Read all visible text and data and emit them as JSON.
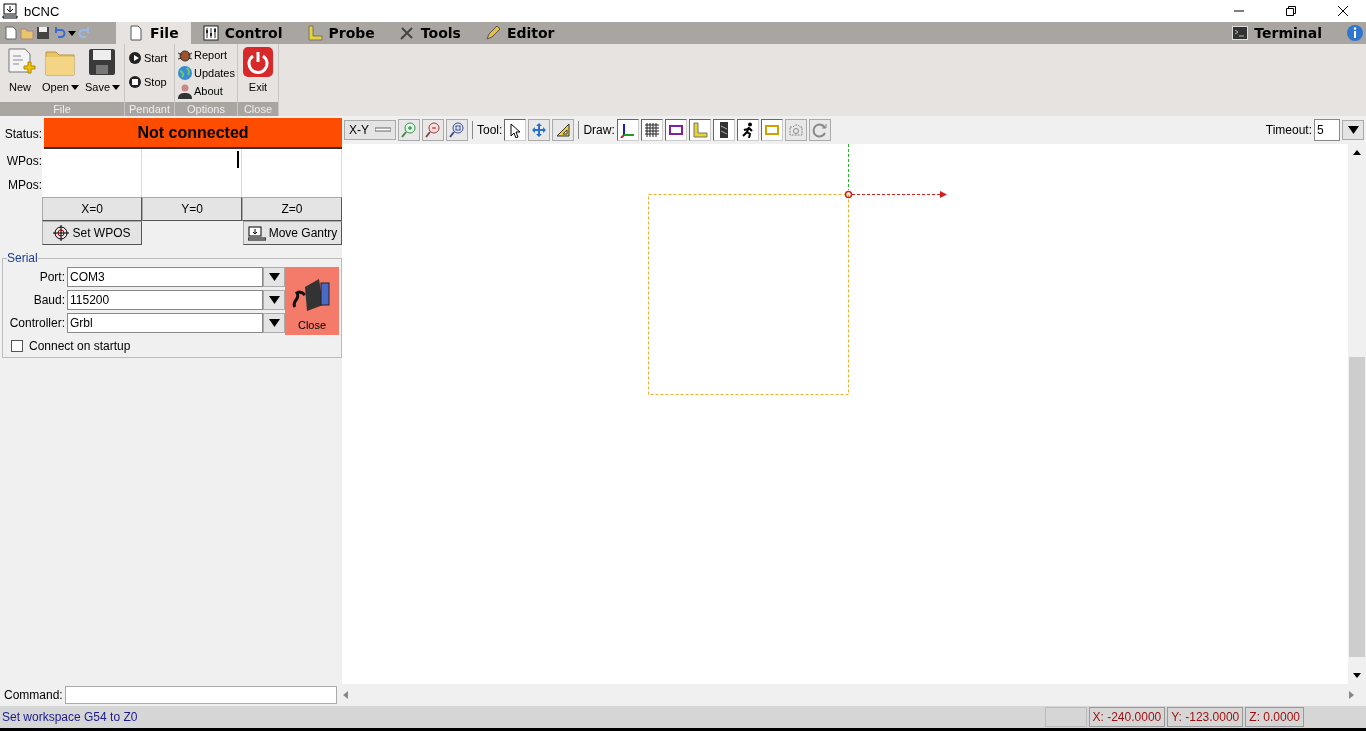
{
  "window": {
    "title": "bCNC"
  },
  "tabs": [
    {
      "label": "File",
      "kind": "file",
      "selected": true
    },
    {
      "label": "Control",
      "kind": "control",
      "selected": false
    },
    {
      "label": "Probe",
      "kind": "probe",
      "selected": false
    },
    {
      "label": "Tools",
      "kind": "tools",
      "selected": false
    },
    {
      "label": "Editor",
      "kind": "editor",
      "selected": false
    }
  ],
  "terminal_tab": {
    "label": "Terminal",
    "selected": false
  },
  "ribbon_groups": [
    {
      "label": "File",
      "kind": "large",
      "buttons": [
        {
          "label": "New",
          "kind": "new",
          "menu": false
        },
        {
          "label": "Open",
          "kind": "open",
          "menu": true
        },
        {
          "label": "Save",
          "kind": "save",
          "menu": true
        }
      ]
    },
    {
      "label": "Pendant",
      "kind": "small",
      "buttons": [
        {
          "label": "Start",
          "kind": "start"
        },
        {
          "label": "Stop",
          "kind": "stop"
        }
      ]
    },
    {
      "label": "Options",
      "kind": "small",
      "buttons": [
        {
          "label": "Report",
          "kind": "report"
        },
        {
          "label": "Updates",
          "kind": "updates"
        },
        {
          "label": "About",
          "kind": "about"
        }
      ]
    },
    {
      "label": "Close",
      "kind": "large",
      "buttons": [
        {
          "label": "Exit",
          "kind": "exit",
          "menu": false
        }
      ]
    }
  ],
  "status": {
    "label": "Status:",
    "value": "Not connected"
  },
  "position_rows": [
    "WPos:",
    "MPos:"
  ],
  "zero_buttons": [
    "X=0",
    "Y=0",
    "Z=0"
  ],
  "set_wpos": "Set WPOS",
  "move_gantry": "Move Gantry",
  "serial": {
    "title": "Serial",
    "fields": [
      {
        "label": "Port:",
        "value": "COM3"
      },
      {
        "label": "Baud:",
        "value": "115200"
      },
      {
        "label": "Controller:",
        "value": "Grbl"
      }
    ],
    "close_button": "Close",
    "connect_on_startup": {
      "label": "Connect on startup",
      "checked": false
    }
  },
  "command": {
    "label": "Command:"
  },
  "canvas_toolbar": {
    "view": "X-Y",
    "tool_label": "Tool:",
    "tools": [
      {
        "kind": "select",
        "selected": true
      },
      {
        "kind": "pan",
        "selected": false
      },
      {
        "kind": "ruler",
        "selected": false
      }
    ],
    "draw_label": "Draw:",
    "draw_toggles": [
      {
        "kind": "axes",
        "selected": true
      },
      {
        "kind": "grid",
        "selected": true
      },
      {
        "kind": "margin",
        "selected": true
      },
      {
        "kind": "probe",
        "selected": true
      },
      {
        "kind": "bit",
        "selected": true
      },
      {
        "kind": "rapid",
        "selected": true
      },
      {
        "kind": "workarea",
        "selected": true
      },
      {
        "kind": "camera",
        "selected": false
      },
      {
        "kind": "rotate",
        "selected": false
      }
    ],
    "timeout_label": "Timeout:",
    "timeout_value": "5"
  },
  "status_bar": {
    "message": "Set workspace G54 to Z0",
    "x": "X: -240.0000",
    "y": "Y: -123.0000",
    "z": "Z: 0.0000"
  }
}
